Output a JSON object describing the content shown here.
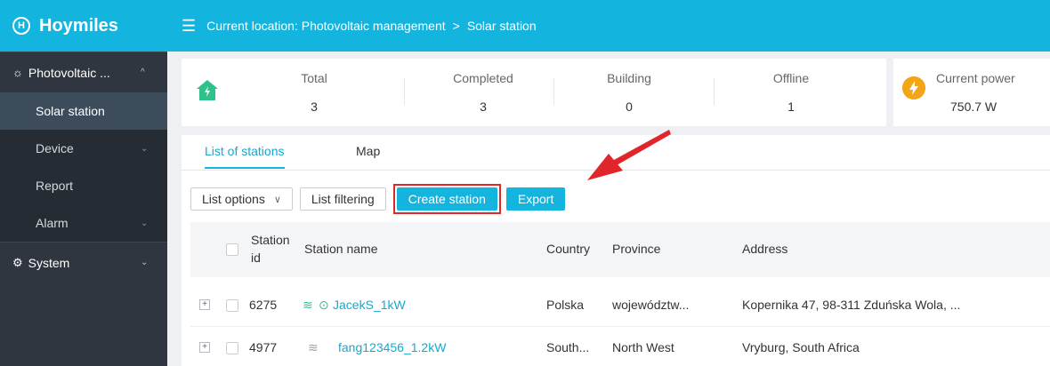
{
  "brand": {
    "logo_mark": "H",
    "name": "Hoymiles"
  },
  "sidebar": {
    "groups": [
      {
        "icon": "sun-gear-icon",
        "label": "Photovoltaic ...",
        "expanded": true
      },
      {
        "icon": "gear-icon",
        "label": "System",
        "expanded": false
      }
    ],
    "items": [
      {
        "label": "Solar station",
        "active": true,
        "has_children": false
      },
      {
        "label": "Device",
        "active": false,
        "has_children": true
      },
      {
        "label": "Report",
        "active": false,
        "has_children": false
      },
      {
        "label": "Alarm",
        "active": false,
        "has_children": true
      }
    ]
  },
  "topbar": {
    "prefix": "Current location: Photovoltaic management",
    "separator": ">",
    "current": "Solar station"
  },
  "stats": [
    {
      "label": "Total",
      "value": "3"
    },
    {
      "label": "Completed",
      "value": "3"
    },
    {
      "label": "Building",
      "value": "0"
    },
    {
      "label": "Offline",
      "value": "1"
    }
  ],
  "power": {
    "label": "Current power",
    "value": "750.7 W"
  },
  "tabs": [
    {
      "label": "List of stations",
      "active": true
    },
    {
      "label": "Map",
      "active": false
    }
  ],
  "toolbar": {
    "list_options": "List options",
    "list_filtering": "List filtering",
    "create_station": "Create station",
    "export": "Export"
  },
  "table": {
    "columns": [
      "Station",
      "id",
      "Station name",
      "Country",
      "Province",
      "Address"
    ],
    "rows": [
      {
        "id": "6275",
        "name": "JacekS_1kW",
        "country": "Polska",
        "province": "województw...",
        "address": "Kopernika 47, 98-311 Zduńska Wola, ...",
        "online": true
      },
      {
        "id": "4977",
        "name": "fang123456_1.2kW",
        "country": "South...",
        "province": "North West",
        "address": "Vryburg, South Africa",
        "online": false
      }
    ]
  },
  "colors": {
    "accent": "#13b5de",
    "sidebar": "#2f3640",
    "highlight": "#e0262b",
    "home": "#2ec28a",
    "power": "#f2a516"
  }
}
